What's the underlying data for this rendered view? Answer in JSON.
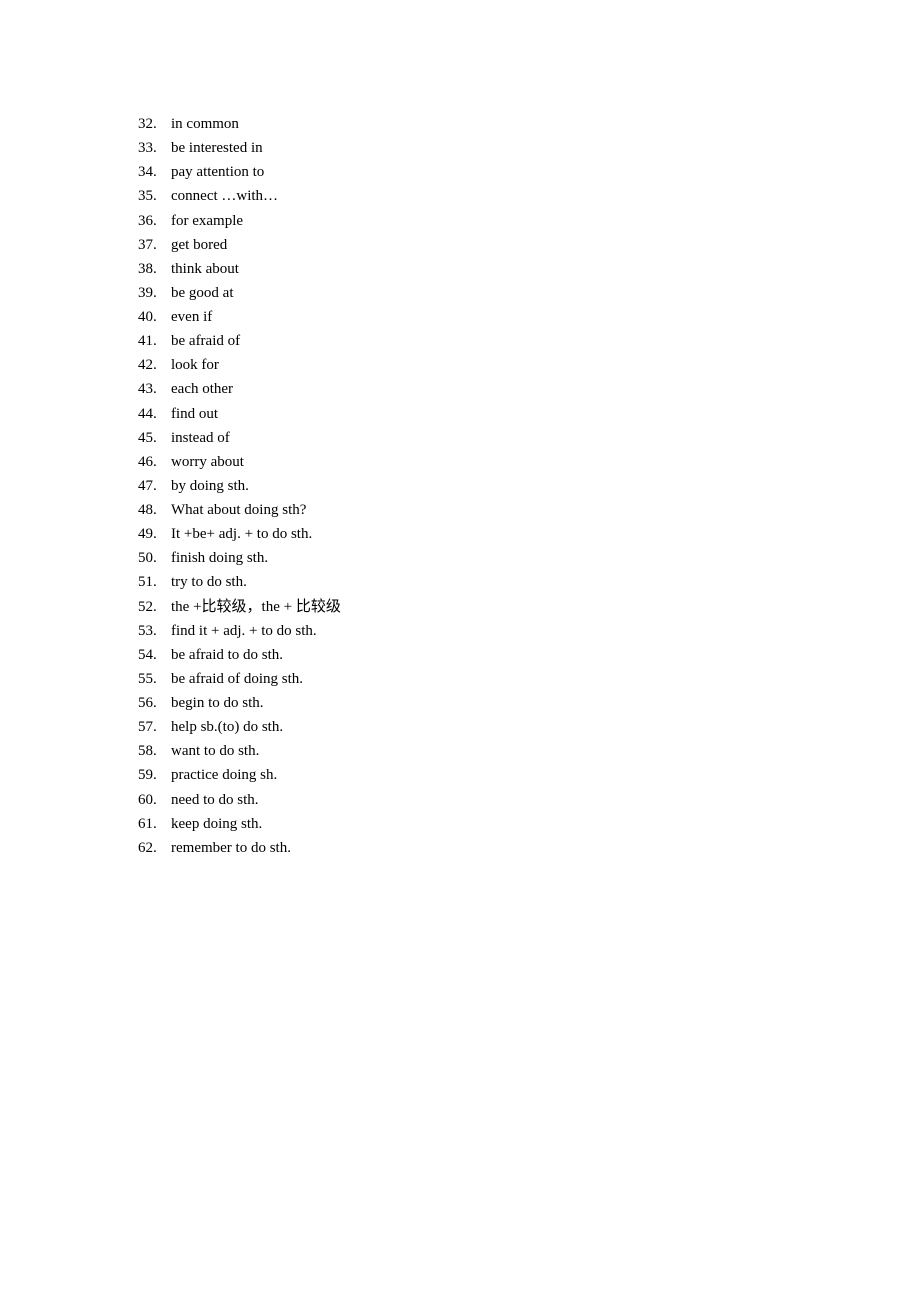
{
  "document": {
    "items": [
      {
        "number": "32.",
        "text": "in common"
      },
      {
        "number": "33.",
        "text": "be interested in"
      },
      {
        "number": "34.",
        "text": "pay attention to"
      },
      {
        "number": "35.",
        "text": "connect …with…"
      },
      {
        "number": "36.",
        "text": "for example"
      },
      {
        "number": "37.",
        "text": "get bored"
      },
      {
        "number": "38.",
        "text": "think about"
      },
      {
        "number": "39.",
        "text": "be good at"
      },
      {
        "number": "40.",
        "text": "even if"
      },
      {
        "number": "41.",
        "text": "be afraid of"
      },
      {
        "number": "42.",
        "text": "look for"
      },
      {
        "number": "43.",
        "text": "each other"
      },
      {
        "number": "44.",
        "text": "find out"
      },
      {
        "number": "45.",
        "text": "instead of"
      },
      {
        "number": "46.",
        "text": "worry about"
      },
      {
        "number": "47.",
        "text": "by doing sth."
      },
      {
        "number": "48.",
        "text": "What about doing sth?"
      },
      {
        "number": "49.",
        "text": "It +be+ adj. + to do sth."
      },
      {
        "number": "50.",
        "text": "finish doing sth."
      },
      {
        "number": "51.",
        "text": "try to do sth."
      },
      {
        "number": "52.",
        "text": "the +比较级，the +  比较级"
      },
      {
        "number": "53.",
        "text": "find it + adj. + to do sth."
      },
      {
        "number": "54.",
        "text": "be afraid to do sth."
      },
      {
        "number": "55.",
        "text": "be afraid of doing sth."
      },
      {
        "number": "56.",
        "text": "begin to do sth."
      },
      {
        "number": "57.",
        "text": "help sb.(to) do sth."
      },
      {
        "number": "58.",
        "text": "want to do sth."
      },
      {
        "number": "59.",
        "text": "practice doing sh."
      },
      {
        "number": "60.",
        "text": "need to do sth."
      },
      {
        "number": "61.",
        "text": "keep doing sth."
      },
      {
        "number": "62.",
        "text": "remember to do sth."
      }
    ]
  }
}
